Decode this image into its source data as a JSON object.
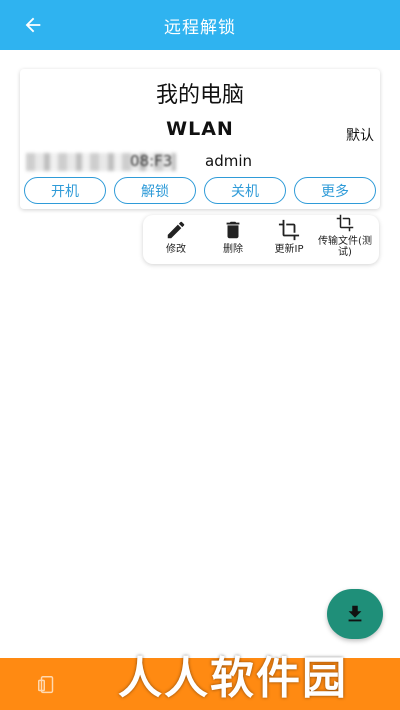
{
  "appbar": {
    "title": "远程解锁",
    "back_icon": "arrow-left-icon"
  },
  "device": {
    "name": "我的电脑",
    "network": "WLAN",
    "default_badge": "默认",
    "mac_visible_tail": "08:F3",
    "username": "admin"
  },
  "actions": [
    {
      "label": "开机"
    },
    {
      "label": "解锁"
    },
    {
      "label": "关机"
    },
    {
      "label": "更多"
    }
  ],
  "more_menu": [
    {
      "label": "修改",
      "icon": "pencil-icon"
    },
    {
      "label": "删除",
      "icon": "trash-icon"
    },
    {
      "label": "更新IP",
      "icon": "crop-icon"
    },
    {
      "label": "传输文件(测试)",
      "icon": "crop-icon"
    }
  ],
  "fab": {
    "icon": "download-icon"
  },
  "bottom_nav": {
    "icon": "device-icon"
  },
  "watermark": "人人软件园",
  "colors": {
    "appbar": "#2fb3f0",
    "accent": "#2f9bd8",
    "fab": "#1f8f79",
    "bottom_bar": "#ff8a12"
  }
}
